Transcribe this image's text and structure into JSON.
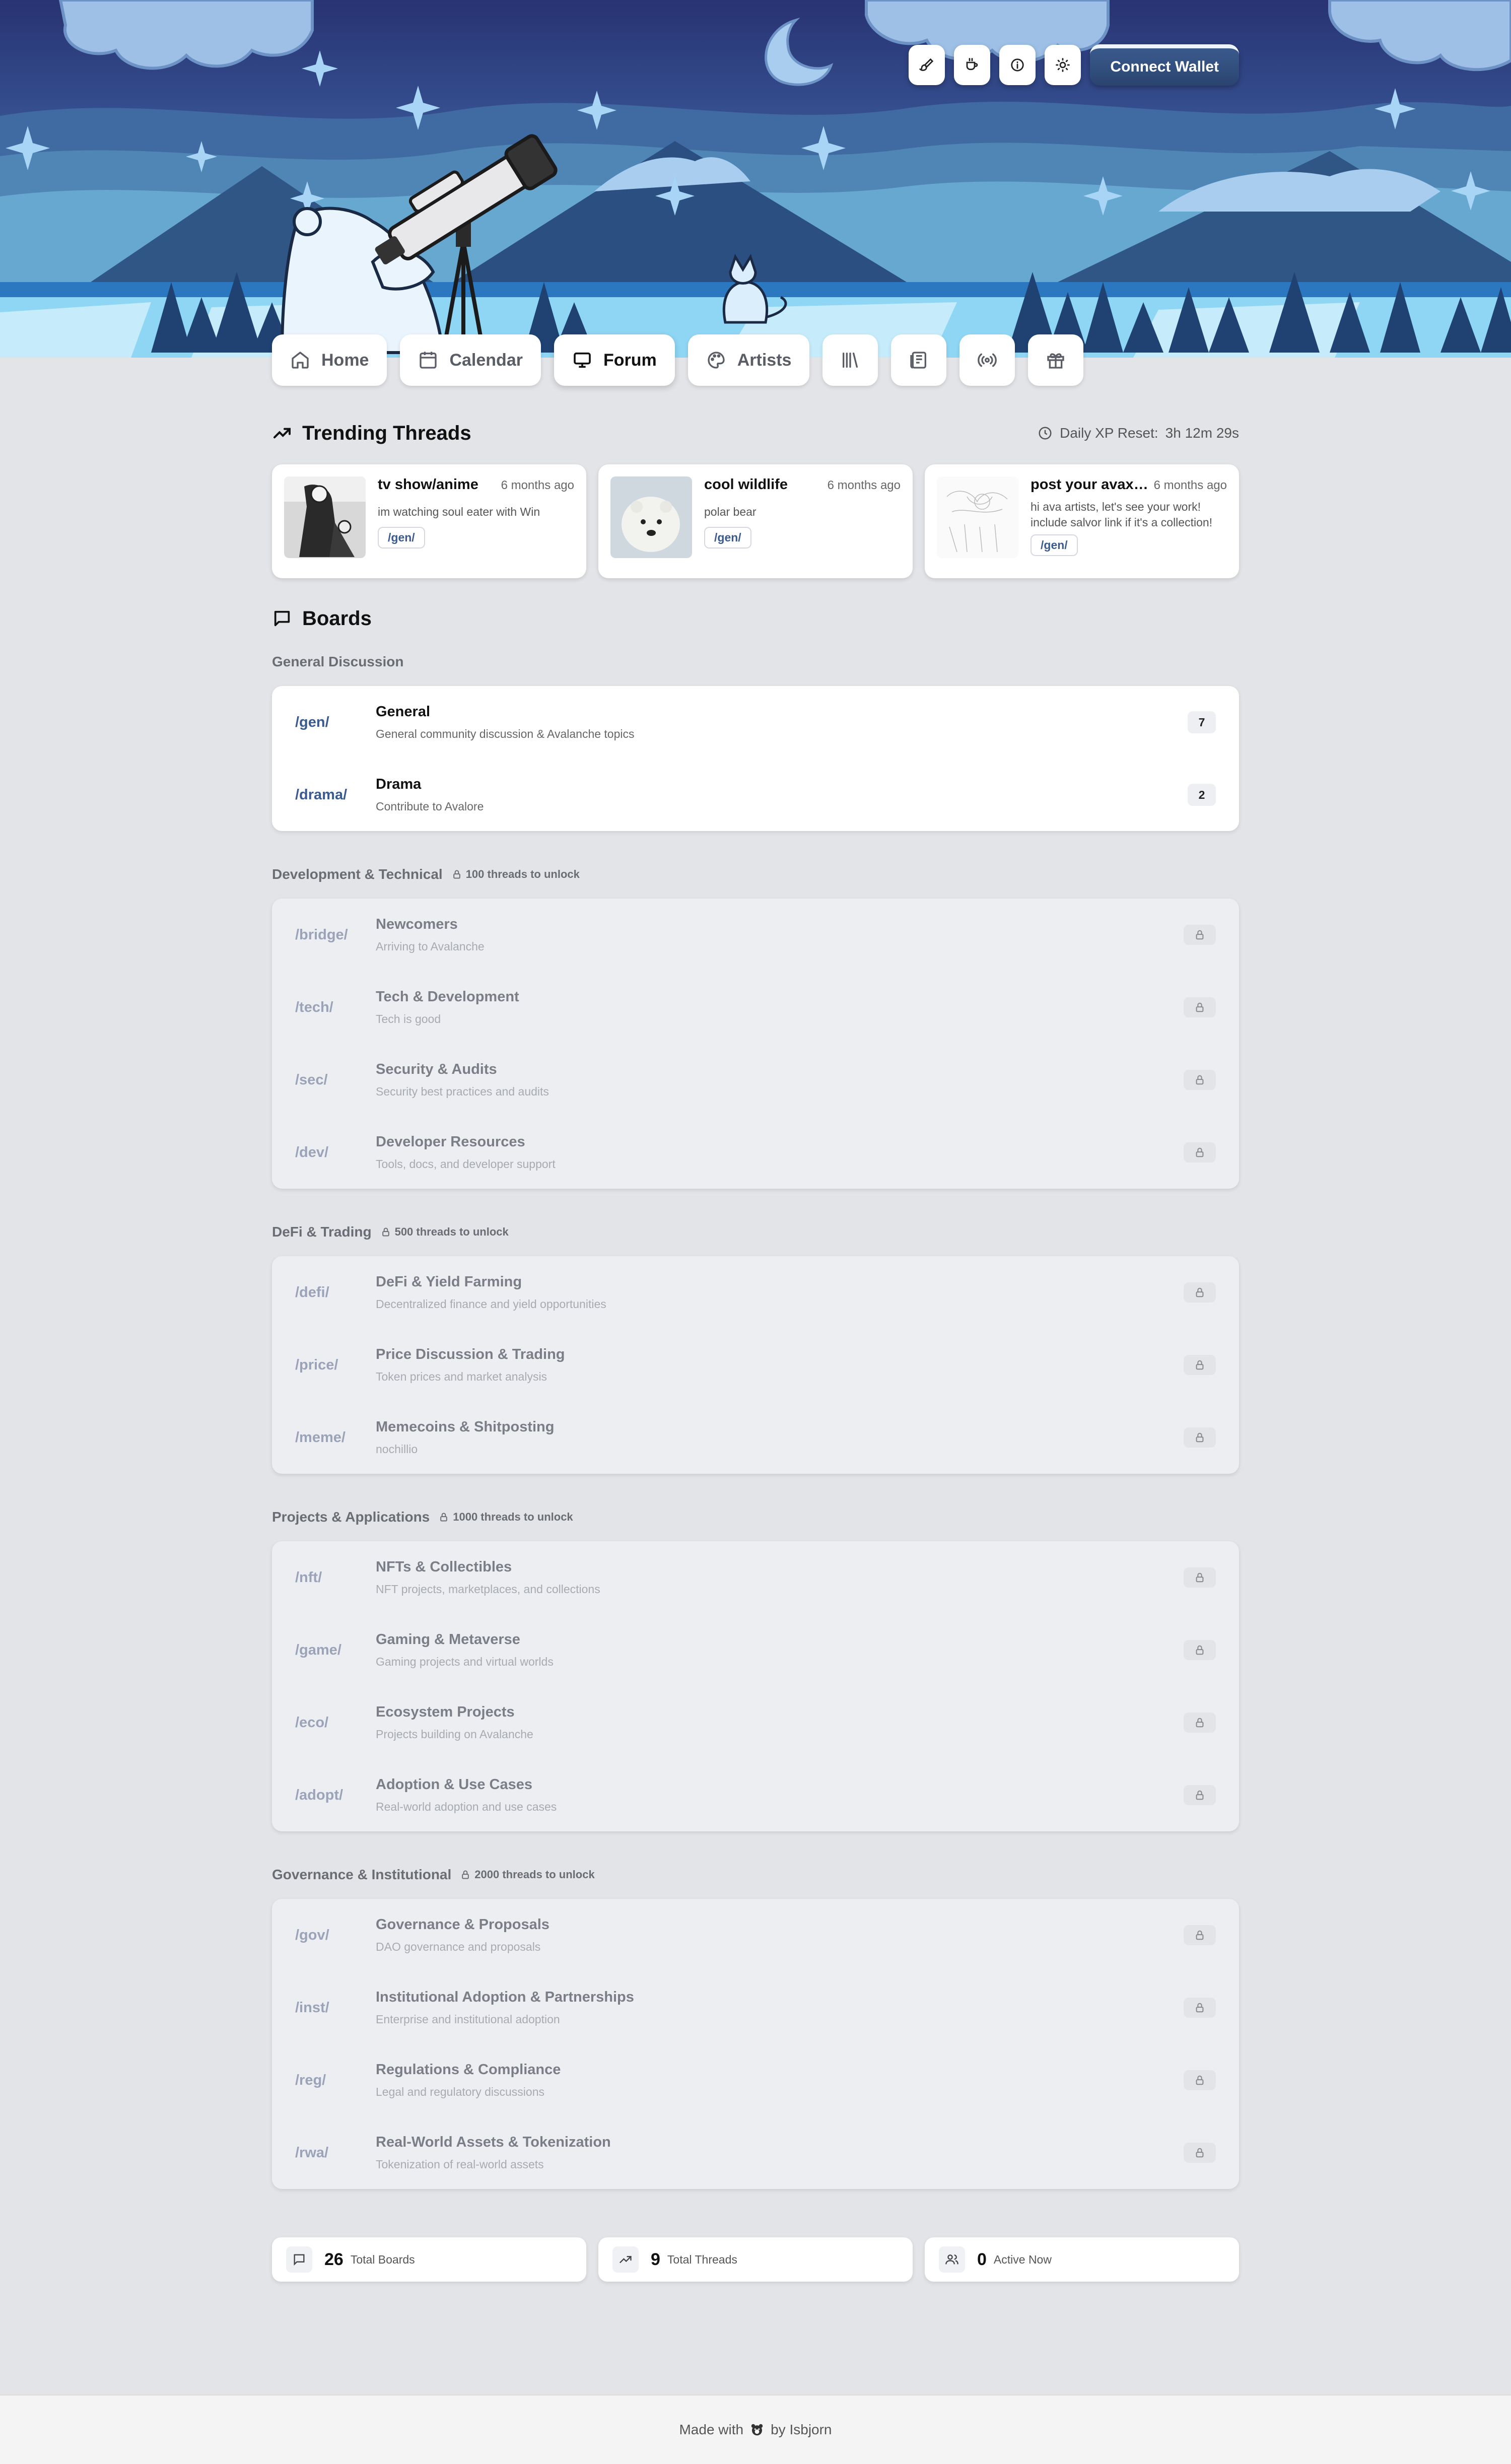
{
  "header": {
    "connect_label": "Connect Wallet",
    "action_icons": [
      "brush-icon",
      "coffee-icon",
      "info-icon",
      "sun-icon"
    ]
  },
  "nav": {
    "tabs": [
      {
        "label": "Home",
        "icon": "home-icon"
      },
      {
        "label": "Calendar",
        "icon": "calendar-icon"
      },
      {
        "label": "Forum",
        "icon": "monitor-icon",
        "active": true
      },
      {
        "label": "Artists",
        "icon": "palette-icon"
      },
      {
        "label": "",
        "icon": "library-icon"
      },
      {
        "label": "",
        "icon": "newspaper-icon"
      },
      {
        "label": "",
        "icon": "radio-icon"
      },
      {
        "label": "",
        "icon": "gift-icon"
      }
    ]
  },
  "trending": {
    "title": "Trending Threads",
    "reset_label": "Daily XP Reset:",
    "reset_time": "3h 12m 29s",
    "threads": [
      {
        "title": "tv show/anime",
        "time": "6 months ago",
        "snippet": "im watching soul eater with Win",
        "tag": "/gen/"
      },
      {
        "title": "cool wildlife",
        "time": "6 months ago",
        "snippet": "polar bear",
        "tag": "/gen/"
      },
      {
        "title": "post your avax art",
        "time": "6 months ago",
        "snippet": "hi ava artists, let's see your work! include salvor link if it's a collection!",
        "tag": "/gen/"
      }
    ]
  },
  "boards": {
    "title": "Boards",
    "categories": [
      {
        "name": "General Discussion",
        "lock_note": "",
        "locked": false,
        "boards": [
          {
            "slug": "/gen/",
            "name": "General",
            "desc": "General community discussion & Avalanche topics",
            "count": "7"
          },
          {
            "slug": "/drama/",
            "name": "Drama",
            "desc": "Contribute to Avalore",
            "count": "2"
          }
        ]
      },
      {
        "name": "Development & Technical",
        "lock_note": "100 threads to unlock",
        "locked": true,
        "boards": [
          {
            "slug": "/bridge/",
            "name": "Newcomers",
            "desc": "Arriving to Avalanche"
          },
          {
            "slug": "/tech/",
            "name": "Tech & Development",
            "desc": "Tech is good"
          },
          {
            "slug": "/sec/",
            "name": "Security & Audits",
            "desc": "Security best practices and audits"
          },
          {
            "slug": "/dev/",
            "name": "Developer Resources",
            "desc": "Tools, docs, and developer support"
          }
        ]
      },
      {
        "name": "DeFi & Trading",
        "lock_note": "500 threads to unlock",
        "locked": true,
        "boards": [
          {
            "slug": "/defi/",
            "name": "DeFi & Yield Farming",
            "desc": "Decentralized finance and yield opportunities"
          },
          {
            "slug": "/price/",
            "name": "Price Discussion & Trading",
            "desc": "Token prices and market analysis"
          },
          {
            "slug": "/meme/",
            "name": "Memecoins & Shitposting",
            "desc": "nochillio"
          }
        ]
      },
      {
        "name": "Projects & Applications",
        "lock_note": "1000 threads to unlock",
        "locked": true,
        "boards": [
          {
            "slug": "/nft/",
            "name": "NFTs & Collectibles",
            "desc": "NFT projects, marketplaces, and collections"
          },
          {
            "slug": "/game/",
            "name": "Gaming & Metaverse",
            "desc": "Gaming projects and virtual worlds"
          },
          {
            "slug": "/eco/",
            "name": "Ecosystem Projects",
            "desc": "Projects building on Avalanche"
          },
          {
            "slug": "/adopt/",
            "name": "Adoption & Use Cases",
            "desc": "Real-world adoption and use cases"
          }
        ]
      },
      {
        "name": "Governance & Institutional",
        "lock_note": "2000 threads to unlock",
        "locked": true,
        "boards": [
          {
            "slug": "/gov/",
            "name": "Governance & Proposals",
            "desc": "DAO governance and proposals"
          },
          {
            "slug": "/inst/",
            "name": "Institutional Adoption & Partnerships",
            "desc": "Enterprise and institutional adoption"
          },
          {
            "slug": "/reg/",
            "name": "Regulations & Compliance",
            "desc": "Legal and regulatory discussions"
          },
          {
            "slug": "/rwa/",
            "name": "Real-World Assets & Tokenization",
            "desc": "Tokenization of real-world assets"
          }
        ]
      }
    ]
  },
  "stats": [
    {
      "value": "26",
      "label": "Total Boards",
      "icon": "message-square-icon"
    },
    {
      "value": "9",
      "label": "Total Threads",
      "icon": "trending-up-icon"
    },
    {
      "value": "0",
      "label": "Active Now",
      "icon": "users-icon"
    }
  ],
  "footer": {
    "prefix": "Made with",
    "suffix": "by Isbjorn",
    "icon": "bear-icon"
  },
  "colors": {
    "accent": "#3b5a90",
    "page_bg": "#e3e4e7",
    "sky": "#2c3a7a"
  }
}
